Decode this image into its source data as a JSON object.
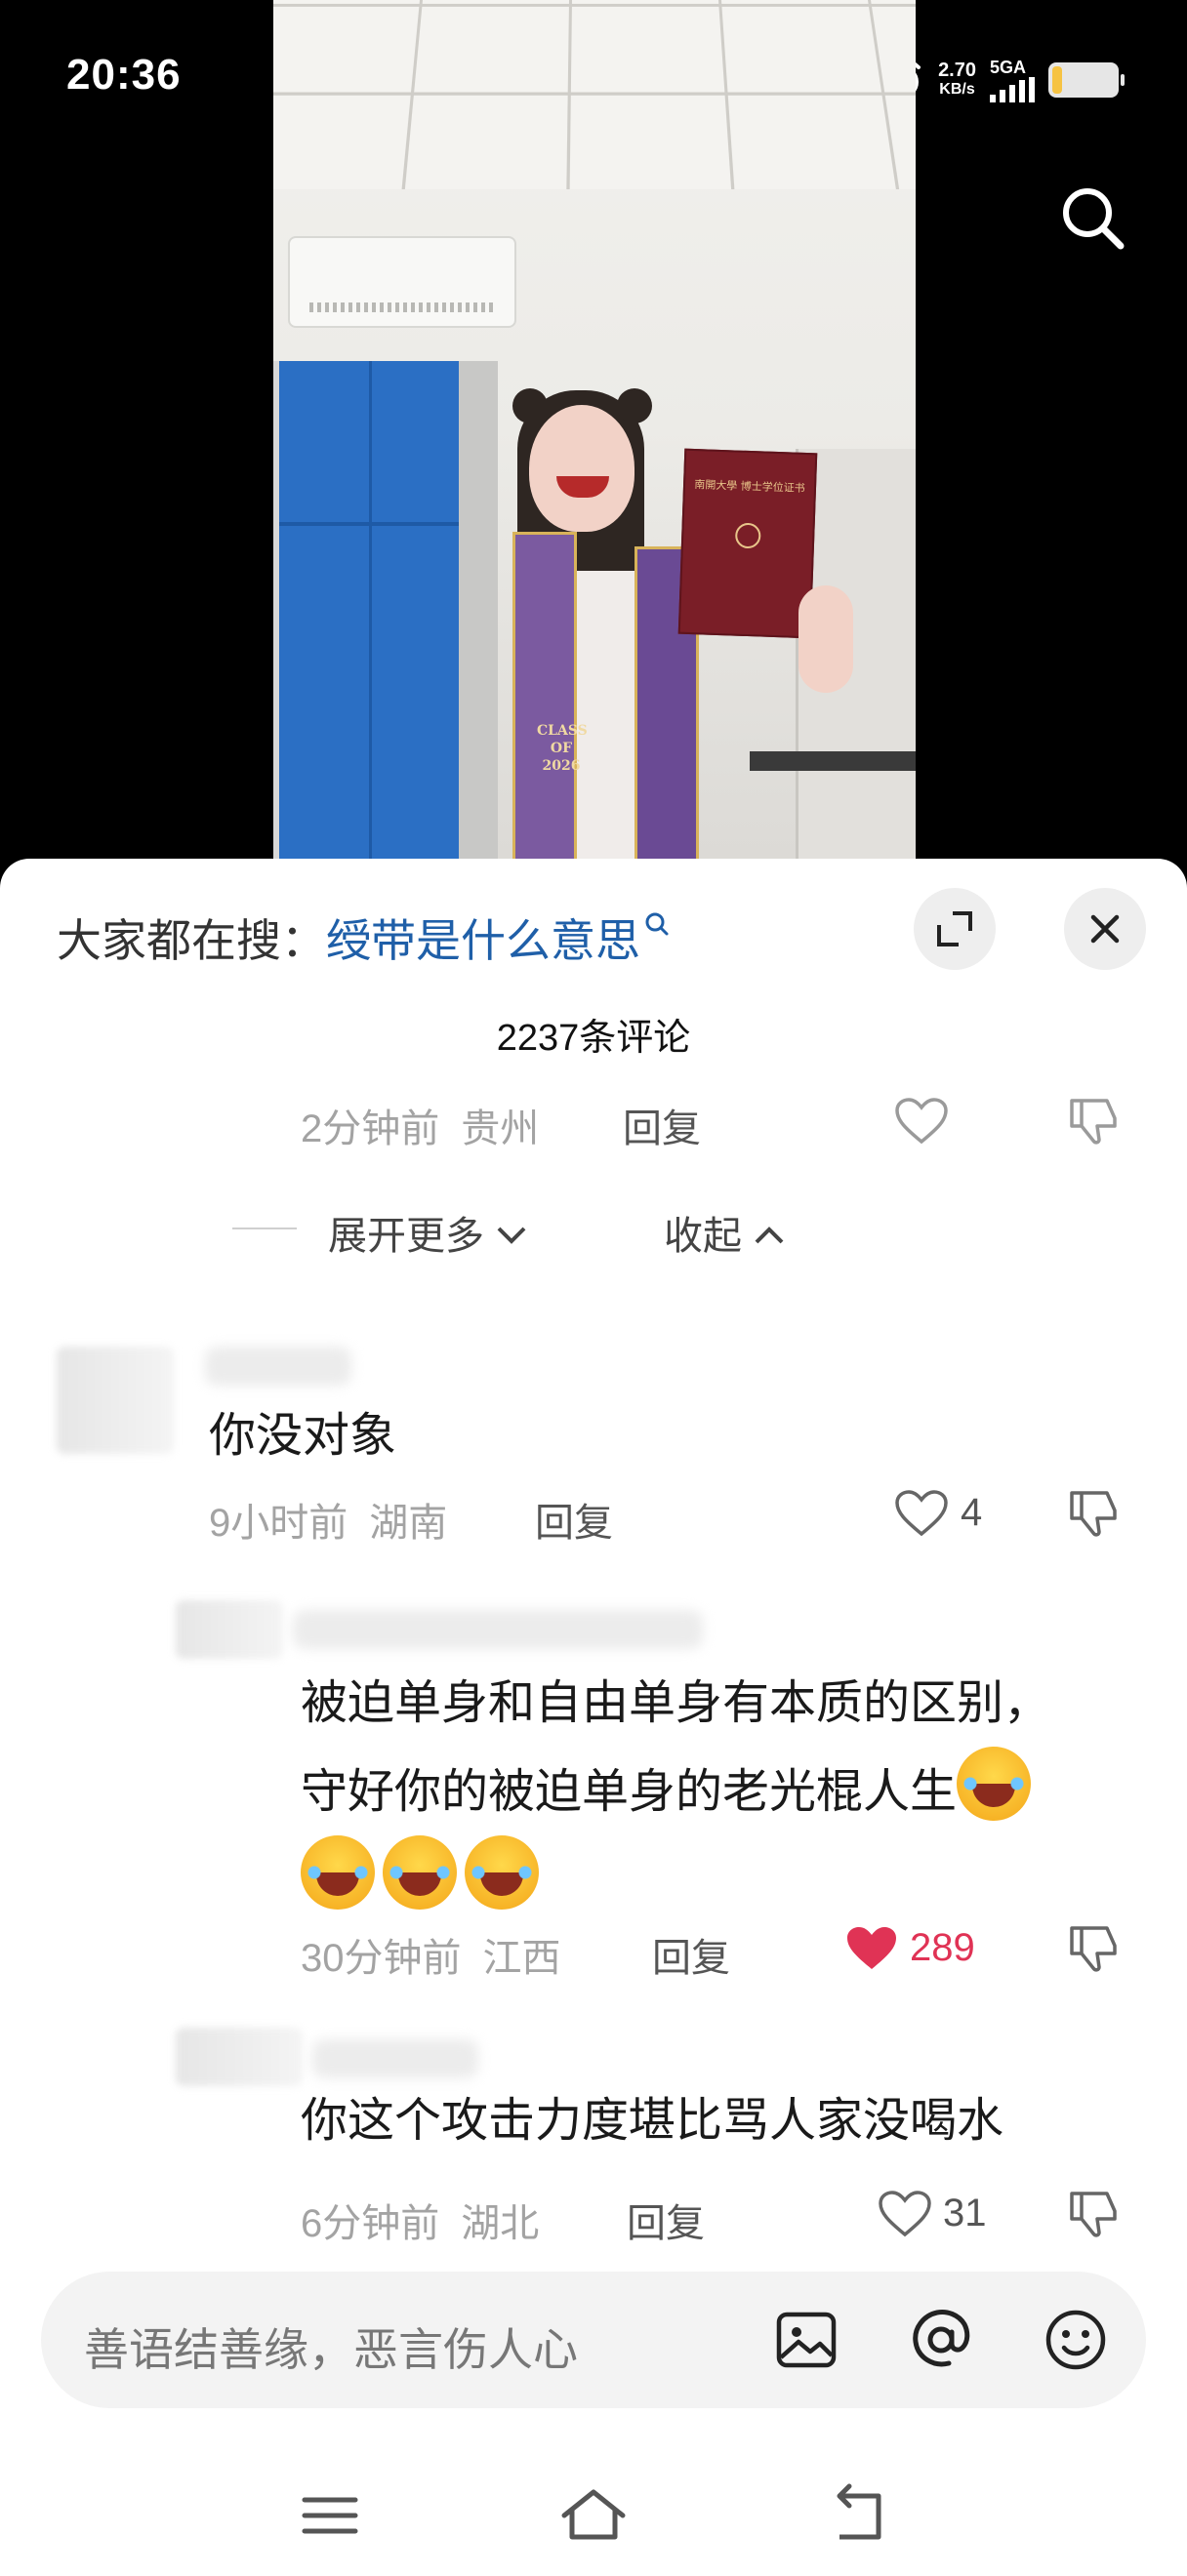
{
  "status": {
    "time": "20:36",
    "net_speed": "2.70",
    "net_unit": "KB/s",
    "signal_label": "5GA",
    "icons": [
      "alarm-icon",
      "signal-icon",
      "battery-icon"
    ]
  },
  "video": {
    "icon": "search-icon",
    "stole_text": "CLASS OF 2026",
    "diploma_text": "南開大學 博士学位证书"
  },
  "comments_panel": {
    "hot_search_prefix": "大家都在搜：",
    "hot_search_keyword": "绶带是什么意思",
    "count": "2237条评论",
    "expand_more": "展开更多",
    "collapse": "收起",
    "reply_label": "回复",
    "partial": {
      "time": "2分钟前",
      "region": "贵州"
    },
    "comments": [
      {
        "text": "你没对象",
        "time": "9小时前",
        "region": "湖南",
        "likes": "4",
        "liked": false
      },
      {
        "text_line1": "被迫单身和自由单身有本质的区别，",
        "text_line2": "守好你的被迫单身的老光棍人生",
        "emoji_count": 4,
        "time": "30分钟前",
        "region": "江西",
        "likes": "289",
        "liked": true
      },
      {
        "text": "你这个攻击力度堪比骂人家没喝水",
        "time": "6分钟前",
        "region": "湖北",
        "likes": "31",
        "liked": false
      }
    ]
  },
  "input": {
    "placeholder": "善语结善缘，恶言伤人心",
    "icons": [
      "image-icon",
      "at-icon",
      "emoji-icon"
    ]
  },
  "colors": {
    "accent_blue": "#1f5fa8",
    "like_red": "#e03355"
  }
}
